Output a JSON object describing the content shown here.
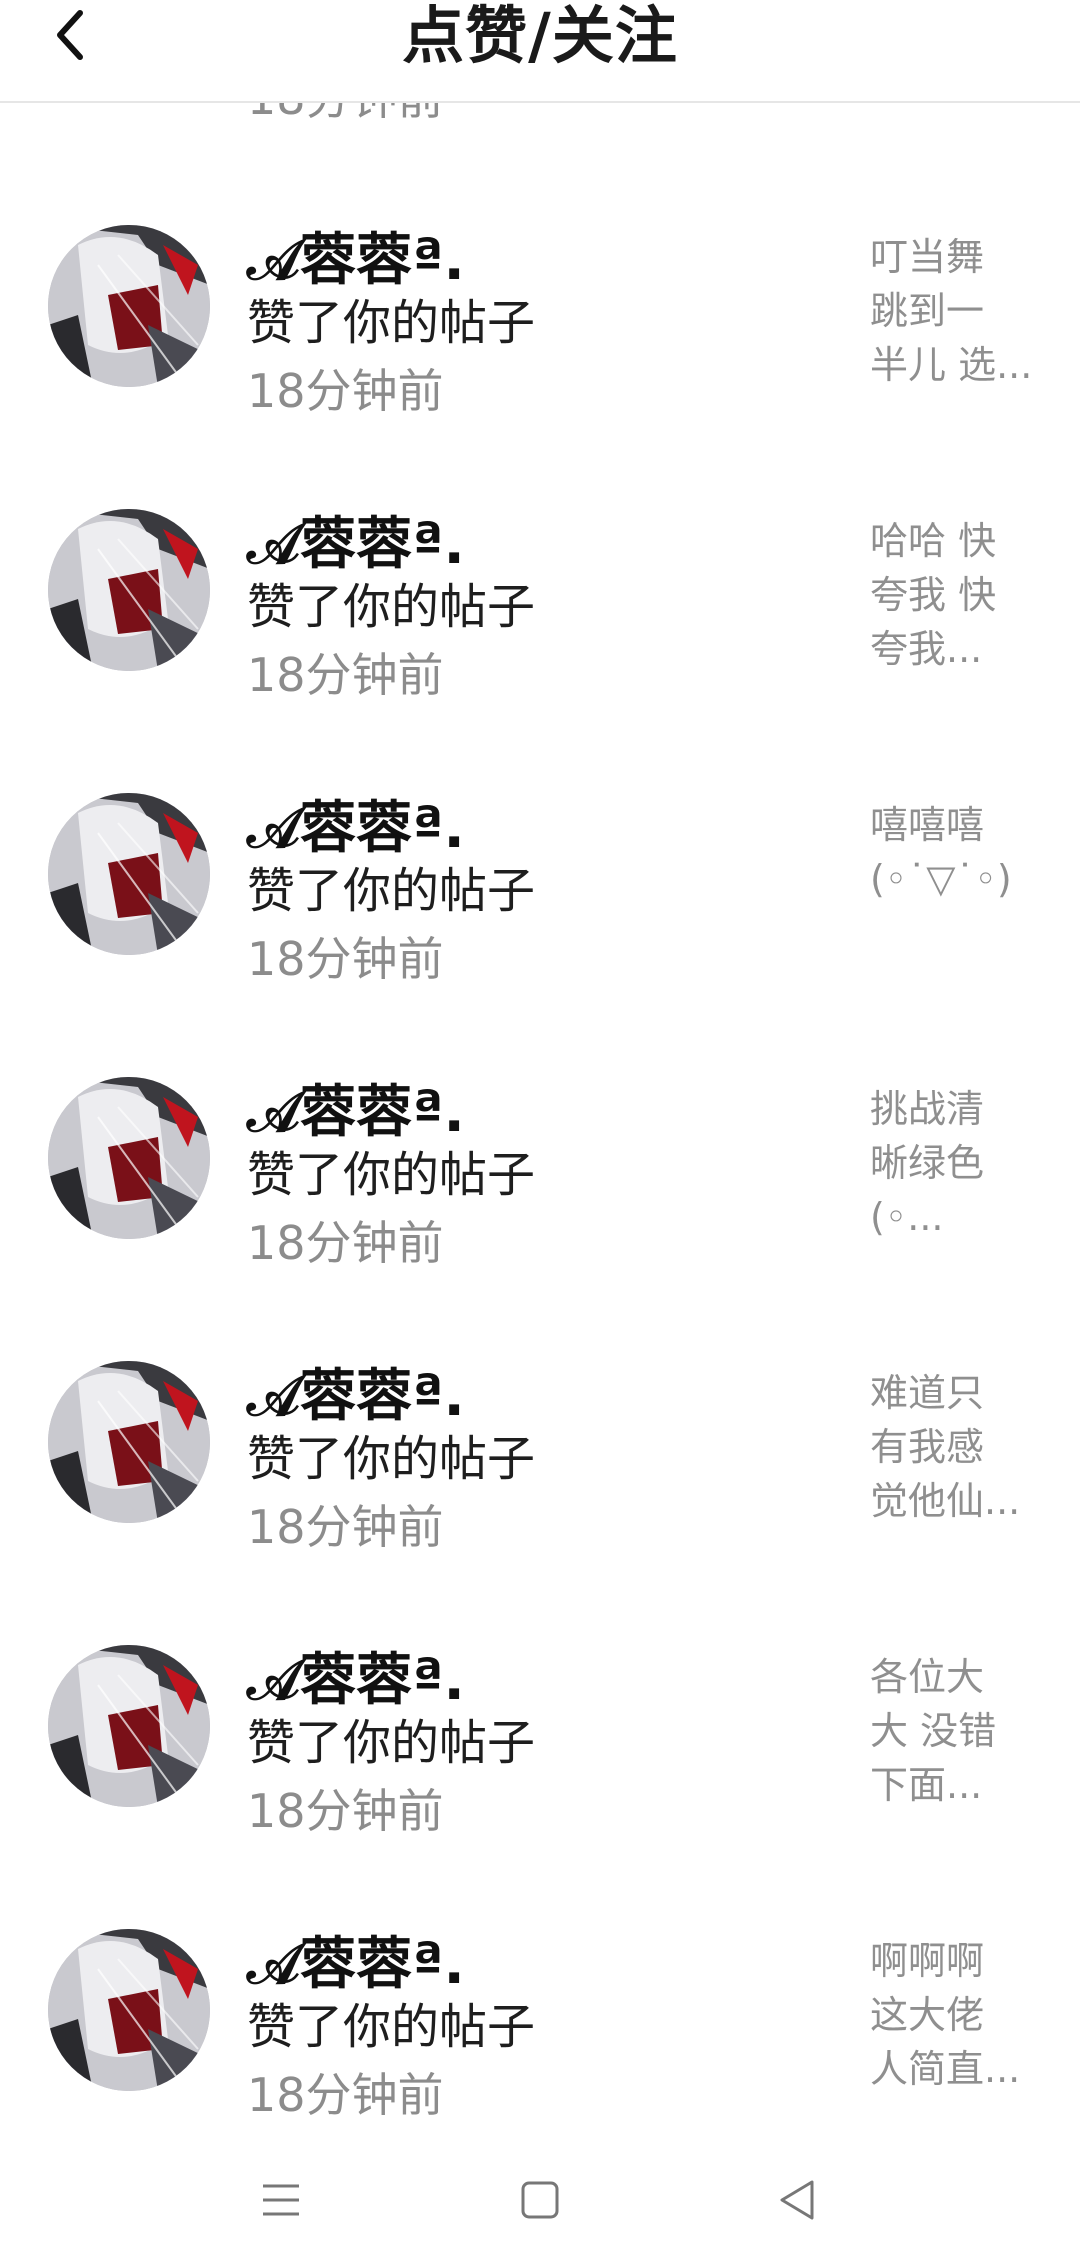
{
  "header": {
    "title": "点赞/关注",
    "back_icon": "chevron-left-icon"
  },
  "peek": {
    "time": "18分钟前"
  },
  "notifications": [
    {
      "username": "𝒜蓉蓉ª.",
      "action": "赞了你的帖子",
      "time": "18分钟前",
      "preview": [
        "叮当舞",
        "跳到一",
        "半儿 选..."
      ]
    },
    {
      "username": "𝒜蓉蓉ª.",
      "action": "赞了你的帖子",
      "time": "18分钟前",
      "preview": [
        "哈哈 快",
        "夸我 快",
        "夸我..."
      ]
    },
    {
      "username": "𝒜蓉蓉ª.",
      "action": "赞了你的帖子",
      "time": "18分钟前",
      "preview": [
        "嘻嘻嘻",
        "(◦˙▽˙◦)"
      ]
    },
    {
      "username": "𝒜蓉蓉ª.",
      "action": "赞了你的帖子",
      "time": "18分钟前",
      "preview": [
        "挑战清",
        "晰绿色",
        "(◦..."
      ]
    },
    {
      "username": "𝒜蓉蓉ª.",
      "action": "赞了你的帖子",
      "time": "18分钟前",
      "preview": [
        "难道只",
        "有我感",
        "觉他仙..."
      ]
    },
    {
      "username": "𝒜蓉蓉ª.",
      "action": "赞了你的帖子",
      "time": "18分钟前",
      "preview": [
        "各位大",
        "大 没错",
        "下面..."
      ]
    },
    {
      "username": "𝒜蓉蓉ª.",
      "action": "赞了你的帖子",
      "time": "18分钟前",
      "preview": [
        "啊啊啊",
        "这大佬",
        "人简直..."
      ]
    }
  ],
  "system_nav": {
    "menu_icon": "menu-icon",
    "home_icon": "home-square-icon",
    "back_icon": "back-triangle-icon"
  }
}
